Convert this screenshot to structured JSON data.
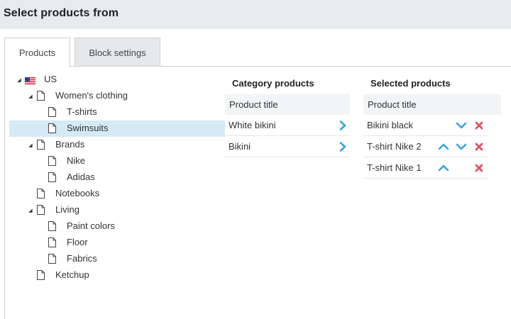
{
  "page": {
    "title": "Select products from"
  },
  "tabs": [
    {
      "label": "Products",
      "active": true
    },
    {
      "label": "Block settings",
      "active": false
    }
  ],
  "tree": [
    {
      "label": "US",
      "expanded": true,
      "icon": "us-flag-icon"
    },
    {
      "label": "Women's clothing",
      "expanded": true,
      "icon": "document-icon"
    },
    {
      "label": "T-shirts",
      "icon": "document-icon"
    },
    {
      "label": "Swimsuits",
      "icon": "document-icon",
      "selected": true
    },
    {
      "label": "Brands",
      "expanded": true,
      "icon": "document-icon"
    },
    {
      "label": "Nike",
      "icon": "document-icon"
    },
    {
      "label": "Adidas",
      "icon": "document-icon"
    },
    {
      "label": "Notebooks",
      "icon": "document-icon"
    },
    {
      "label": "Living",
      "expanded": true,
      "icon": "document-icon"
    },
    {
      "label": "Paint colors",
      "icon": "document-icon"
    },
    {
      "label": "Floor",
      "icon": "document-icon"
    },
    {
      "label": "Fabrics",
      "icon": "document-icon"
    },
    {
      "label": "Ketchup",
      "icon": "document-icon"
    }
  ],
  "category_products": {
    "title": "Category products",
    "column_header": "Product title",
    "rows": [
      {
        "title": "White bikini",
        "action": "add-arrow-icon"
      },
      {
        "title": "Bikini",
        "action": "add-arrow-icon"
      }
    ]
  },
  "selected_products": {
    "title": "Selected products",
    "column_header": "Product title",
    "rows": [
      {
        "title": "Bikini black",
        "actions": [
          "move-down-icon",
          "remove-icon"
        ]
      },
      {
        "title": "T-shirt Nike 2",
        "actions": [
          "move-up-icon",
          "move-down-icon",
          "remove-icon"
        ]
      },
      {
        "title": "T-shirt Nike 1",
        "actions": [
          "move-up-icon",
          "remove-icon"
        ]
      }
    ]
  },
  "colors": {
    "accent_blue": "#3aa3dc",
    "remove_red": "#dd5560",
    "selected_row": "#d4eaf5",
    "header_bg": "#e8ebee"
  }
}
